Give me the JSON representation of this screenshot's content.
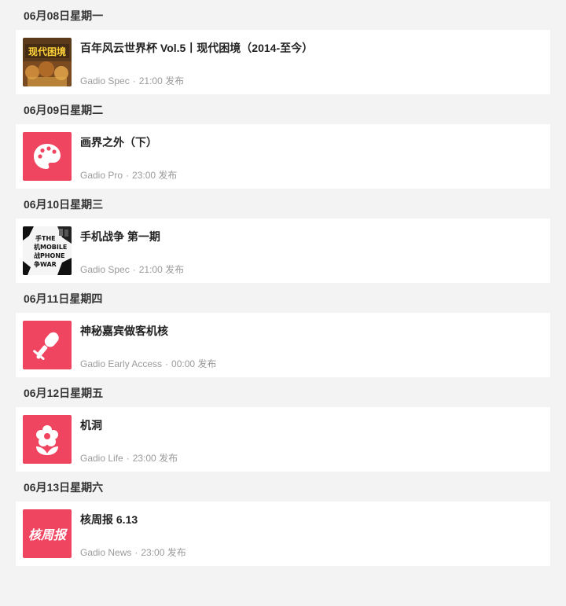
{
  "days": [
    {
      "date": "06月08日星期一",
      "thumb_icon": "world-cup-cover-image",
      "title": "百年风云世界杯 Vol.5丨现代困境（2014-至今）",
      "channel": "Gadio Spec",
      "time": "21:00 发布",
      "cover_text": "现代困境"
    },
    {
      "date": "06月09日星期二",
      "thumb_icon": "palette-icon",
      "title": "画界之外（下）",
      "channel": "Gadio Pro",
      "time": "23:00 发布"
    },
    {
      "date": "06月10日星期三",
      "thumb_icon": "phone-war-cover-image",
      "title": "手机战争 第一期",
      "channel": "Gadio Spec",
      "time": "21:00 发布",
      "cover_text": [
        "手THE",
        "机MOBILE",
        "战PHONE",
        "争WAR"
      ]
    },
    {
      "date": "06月11日星期四",
      "thumb_icon": "microphone-icon",
      "title": "神秘嘉宾做客机核",
      "channel": "Gadio Early Access",
      "time": "00:00 发布"
    },
    {
      "date": "06月12日星期五",
      "thumb_icon": "flower-icon",
      "title": "机洞",
      "channel": "Gadio Life",
      "time": "23:00 发布"
    },
    {
      "date": "06月13日星期六",
      "thumb_icon": "hezhoubao-logo",
      "title": "核周报 6.13",
      "channel": "Gadio News",
      "time": "23:00 发布",
      "cover_text": "核周报"
    }
  ],
  "meta_separator": "·",
  "colors": {
    "accent": "#f04560",
    "background": "#f3f3f3",
    "card": "#ffffff",
    "meta": "#9a9a9a"
  }
}
